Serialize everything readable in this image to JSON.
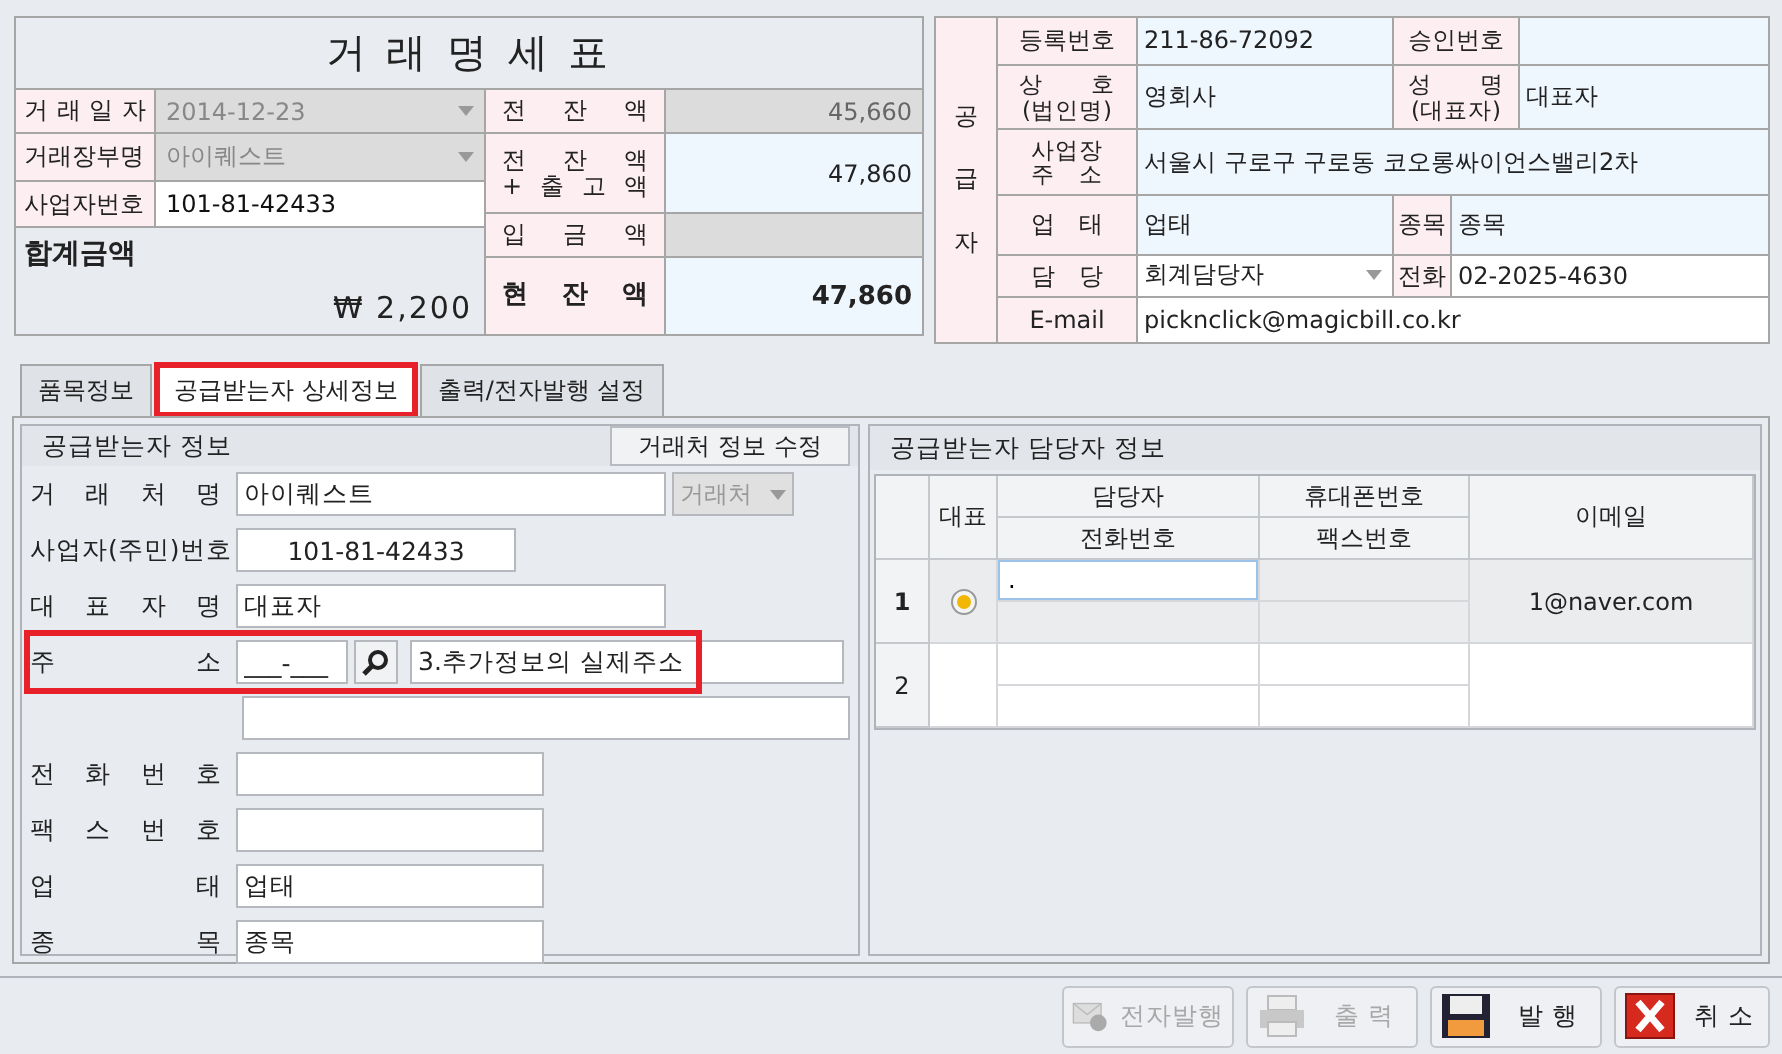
{
  "title": "거 래 명 세 표",
  "transaction": [
    {
      "label": "거 래 일 자",
      "value": "2014-12-23",
      "kind": "dropdown",
      "disabled": true
    },
    {
      "label": "거래장부명",
      "value": "아이퀘스트",
      "kind": "dropdown",
      "disabled": true
    },
    {
      "label": "사업자번호",
      "value": "101-81-42433",
      "kind": "text",
      "disabled": false
    }
  ],
  "total": {
    "label": "합계금액",
    "amount": "₩ 2,200"
  },
  "balances": [
    {
      "lines": [
        "전 잔 액"
      ],
      "value": "45,660",
      "disabled": true,
      "emphasis": false
    },
    {
      "lines": [
        "전 잔 액",
        "+ 출 고 액"
      ],
      "value": "47,860",
      "disabled": false,
      "emphasis": false
    },
    {
      "lines": [
        "입 금 액"
      ],
      "disabled": true,
      "emphasis": false
    },
    {
      "lines": [
        "현 잔 액"
      ],
      "value": "47,860",
      "disabled": false,
      "emphasis": true
    }
  ],
  "supplier": {
    "side_label": "공급자",
    "rows": [
      {
        "fields": [
          {
            "lines": [
              "등록번호"
            ],
            "value": "211-86-72092",
            "editable": false
          },
          {
            "lines": [
              "승인번호"
            ],
            "editable": false,
            "narrow": false
          }
        ]
      },
      {
        "fields": [
          {
            "lines": [
              "상　　호",
              "(법인명)"
            ],
            "value": "영회사",
            "editable": false
          },
          {
            "lines": [
              "성　　명",
              "(대표자)"
            ],
            "value": "대표자",
            "editable": false,
            "narrow": false
          }
        ]
      },
      {
        "fields": [
          {
            "lines": [
              "사업장",
              "주　소"
            ],
            "value": "서울시 구로구 구로동 코오롱싸이언스밸리2차",
            "editable": false
          }
        ]
      },
      {
        "fields": [
          {
            "lines": [
              "업　태"
            ],
            "value": "업태",
            "editable": false
          },
          {
            "lines": [
              "종목"
            ],
            "value": "종목",
            "editable": false,
            "narrow": true
          }
        ]
      },
      {
        "fields": [
          {
            "lines": [
              "담　당"
            ],
            "value": "회계담당자",
            "editable": true,
            "kind": "dropdown"
          },
          {
            "lines": [
              "전화"
            ],
            "value": "02-2025-4630",
            "editable": true,
            "narrow": true
          }
        ]
      },
      {
        "fields": [
          {
            "lines": [
              "E-mail"
            ],
            "value": "picknclick@magicbill.co.kr",
            "editable": true
          }
        ]
      }
    ]
  },
  "tabs": [
    {
      "label": "품목정보",
      "selected": false,
      "highlighted": false
    },
    {
      "label": "공급받는자 상세정보",
      "selected": true,
      "highlighted": true
    },
    {
      "label": "출력/전자발행 설정",
      "selected": false,
      "highlighted": false
    }
  ],
  "recipient": {
    "title": "공급받는자 정보",
    "edit_button": "거래처 정보 수정",
    "fields": [
      {
        "label": "거 래 처 명",
        "value": "아이퀘스트",
        "kind": "text",
        "combo": "거래처"
      },
      {
        "label": "사업자(주민)번호",
        "value": "101-81-42433",
        "kind": "text",
        "centered": true
      },
      {
        "label": "대 표 자 명",
        "value": "대표자",
        "kind": "text"
      },
      {
        "label": "주 소",
        "kind": "address",
        "zip": "___-___",
        "value": "3.추가정보의 실제주소",
        "highlighted": true
      },
      {
        "kind": "line"
      },
      {
        "label": "전 화 번 호",
        "kind": "text"
      },
      {
        "label": "팩 스 번 호",
        "kind": "text"
      },
      {
        "label": "업 태",
        "value": "업태",
        "kind": "text"
      },
      {
        "label": "종 목",
        "value": "종목",
        "kind": "text"
      }
    ]
  },
  "contacts": {
    "title": "공급받는자 담당자 정보",
    "header": {
      "primary": "대표",
      "name": "담당자",
      "phone": "전화번호",
      "mobile": "휴대폰번호",
      "fax": "팩스번호",
      "email": "이메일"
    },
    "rows": [
      {
        "number": "1",
        "selected": true,
        "primary": true,
        "name": ".",
        "editing": true,
        "email": "1@naver.com"
      },
      {
        "number": "2",
        "selected": false,
        "primary": false,
        "editing": false
      }
    ]
  },
  "buttons": [
    {
      "label": "전자발행",
      "kind": "email",
      "disabled": true
    },
    {
      "label": "출 력",
      "kind": "print",
      "disabled": true
    },
    {
      "label": "발 행",
      "kind": "save",
      "disabled": false
    },
    {
      "label": "취 소",
      "kind": "cancel",
      "disabled": false
    }
  ]
}
